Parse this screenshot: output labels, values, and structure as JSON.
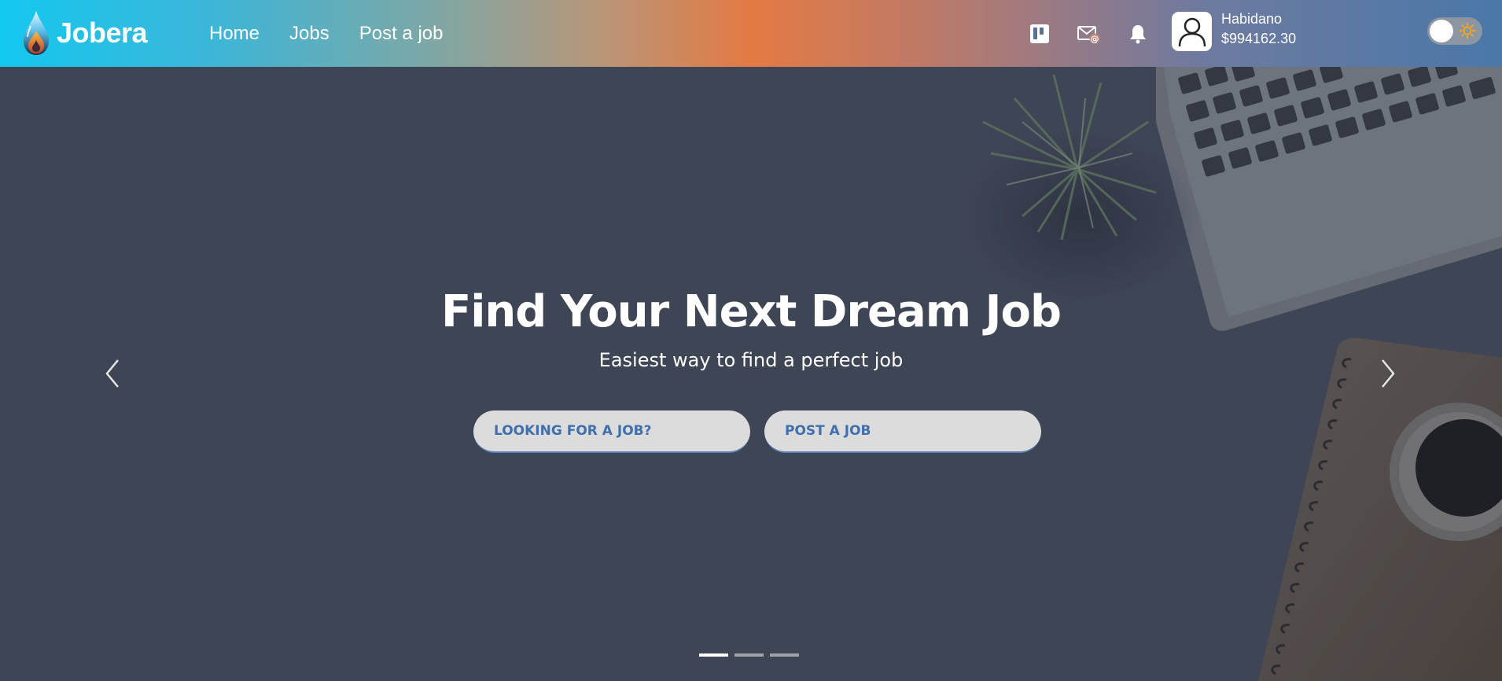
{
  "brand": {
    "name": "Jobera",
    "logo_icon": "flame-drop-logo"
  },
  "nav": {
    "links": [
      "Home",
      "Jobs",
      "Post a job"
    ]
  },
  "header_icons": [
    "kanban-board-icon",
    "mail-at-icon",
    "bell-icon"
  ],
  "user": {
    "name": "Habidano",
    "balance": "$994162.30",
    "avatar_icon": "user-avatar-icon"
  },
  "theme_toggle": {
    "mode": "light",
    "icon": "sun-icon"
  },
  "hero": {
    "title": "Find Your Next Dream Job",
    "subtitle": "Easiest way to find a perfect job",
    "buttons": [
      "LOOKING FOR A JOB?",
      "POST A JOB"
    ]
  },
  "carousel": {
    "slide_count": 3,
    "active_index": 0
  },
  "colors": {
    "button_text": "#3f6fad",
    "button_bg": "#dcdcdc",
    "hero_bg": "#454d5e"
  }
}
